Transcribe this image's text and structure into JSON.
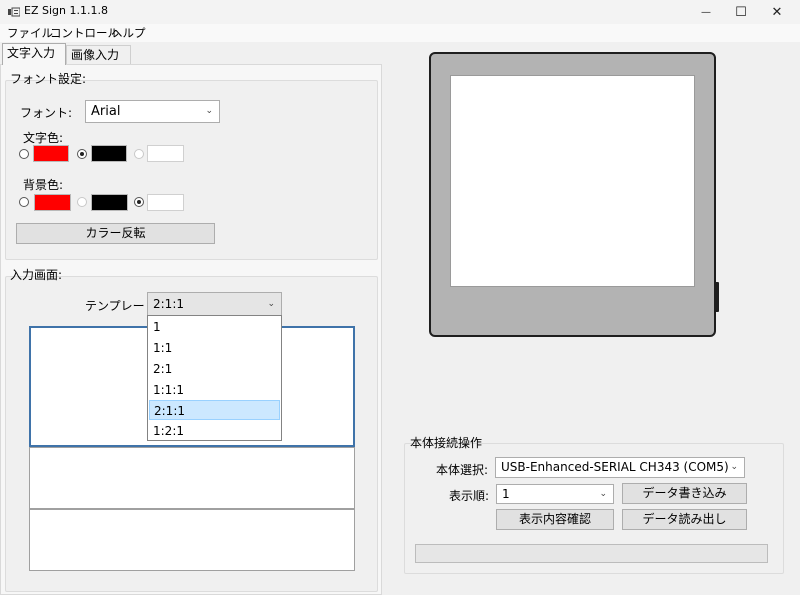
{
  "window": {
    "title": "EZ Sign 1.1.1.8",
    "controls": {
      "minimize": "—",
      "maximize": "☐",
      "close": "✕"
    }
  },
  "menu": [
    "ファイル",
    "コントロール",
    "ヘルプ"
  ],
  "tabs": [
    {
      "label": "文字入力",
      "active": true
    },
    {
      "label": "画像入力",
      "active": false
    }
  ],
  "font_settings": {
    "group_title": "フォント設定:",
    "font_label": "フォント:",
    "font_value": "Arial",
    "text_color_label": "文字色:",
    "text_colors": [
      {
        "color": "#ff0000",
        "checked": false,
        "enabled": true
      },
      {
        "color": "#000000",
        "checked": true,
        "enabled": true
      },
      {
        "color": "#ffffff",
        "checked": false,
        "enabled": false
      }
    ],
    "bg_color_label": "背景色:",
    "bg_colors": [
      {
        "color": "#ff0000",
        "checked": false,
        "enabled": true
      },
      {
        "color": "#000000",
        "checked": false,
        "enabled": false
      },
      {
        "color": "#ffffff",
        "checked": true,
        "enabled": true
      }
    ],
    "invert_button": "カラー反転"
  },
  "input_screen": {
    "group_title": "入力画面:",
    "template_label": "テンプレート:",
    "template_value": "2:1:1",
    "template_options": [
      "1",
      "1:1",
      "2:1",
      "1:1:1",
      "2:1:1",
      "1:2:1"
    ],
    "selected_option": "2:1:1"
  },
  "connection": {
    "group_title": "本体接続操作",
    "device_select_label": "本体選択:",
    "device_select_value": "USB-Enhanced-SERIAL CH343 (COM5)",
    "display_order_label": "表示順:",
    "display_order_value": "1",
    "write_button": "データ書き込み",
    "confirm_button": "表示内容確認",
    "read_button": "データ読み出し"
  }
}
